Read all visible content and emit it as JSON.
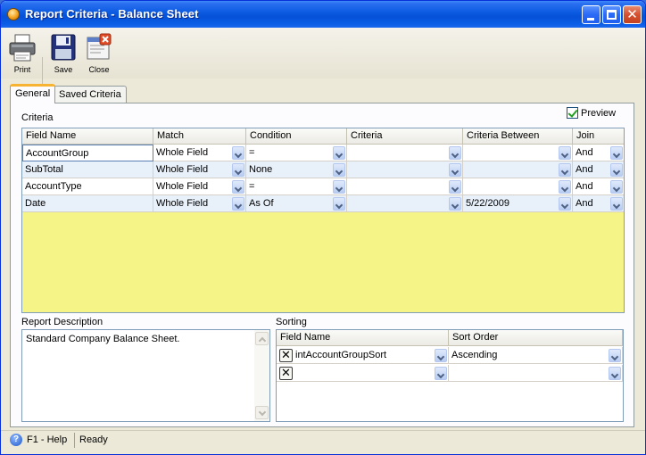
{
  "window": {
    "title": "Report Criteria - Balance Sheet"
  },
  "toolbar": {
    "print_label": "Print",
    "save_label": "Save",
    "close_label": "Close"
  },
  "tabs": [
    {
      "label": "General"
    },
    {
      "label": "Saved Criteria"
    }
  ],
  "criteria": {
    "section_label": "Criteria",
    "preview_label": "Preview",
    "preview_checked": true,
    "columns": [
      "Field Name",
      "Match",
      "Condition",
      "Criteria",
      "Criteria Between",
      "Join"
    ],
    "rows": [
      {
        "field": "AccountGroup",
        "match": "Whole Field",
        "condition": "=",
        "criteria": "",
        "between": "",
        "join": "And"
      },
      {
        "field": "SubTotal",
        "match": "Whole Field",
        "condition": "None",
        "criteria": "",
        "between": "",
        "join": "And"
      },
      {
        "field": "AccountType",
        "match": "Whole Field",
        "condition": "=",
        "criteria": "",
        "between": "",
        "join": "And"
      },
      {
        "field": "Date",
        "match": "Whole Field",
        "condition": "As Of",
        "criteria": "",
        "between": "5/22/2009",
        "join": "And"
      }
    ]
  },
  "description": {
    "label": "Report Description",
    "text": "Standard Company Balance Sheet."
  },
  "sorting": {
    "label": "Sorting",
    "columns": [
      "Field Name",
      "Sort Order"
    ],
    "rows": [
      {
        "field": "intAccountGroupSort",
        "order": "Ascending"
      },
      {
        "field": "",
        "order": ""
      }
    ]
  },
  "status": {
    "help": "F1 - Help",
    "state": "Ready"
  },
  "colors": {
    "titlebar": "#0651d8",
    "grid_background": "#f5f486",
    "active_tab_accent": "#f7b432"
  }
}
